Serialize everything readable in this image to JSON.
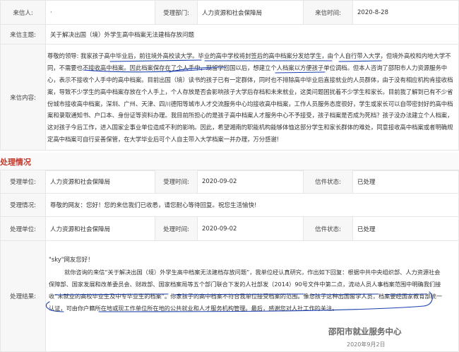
{
  "letter": {
    "row1": {
      "sender_label": "来信人:",
      "sender_value": "·",
      "dept_label": "受理部门:",
      "dept_value": "人力资源和社会保障局",
      "time_label": "来信时间:",
      "time_value": "2020-8-28"
    },
    "subject_label": "来信主题:",
    "subject_value": "关于解决出国（境）外学生高中档案无法建档存放问题",
    "content_label": "来信内容:",
    "content_value": "尊敬的领导: 我家孩子高中毕业后，前往境外高校读大学。毕业的高中学校将封签后的高中档案分发给学生，由个人自行带入大学，但境外高校和内地大学不同，不需要也不接收高中档案。因此档案保存在了个人手中，现留学回国以后，想建立个人档案以方便孩子单位调档。但本人咨询了邵阳市人力资源服务中心，表示不接收个人手中的高中档案。目前出国（境）读书的孩子已有一定群体，同时也不排除高中毕业后直接就业的人员群体，由于没有相应机构肯接收档案，导致不少学生的高中档案存放在个人手上，个人存放是否会影响孩子大学后存档和未来就业，这类问题困扰着不少学生和家长。目前我了解到已有不少省份城市接收高中档案，深圳、广州、天津、四川德阳等城市人才交流服务中心均接收高中档案，工作人员服务态度很好，学生或家长可以自带密封好的高中档案和录取通知书、户口本、身份证等资料办理。我目前所担心的是孩子高中档案人才服务中心不予接受，孩子档案是否成为死档？孩子没办法建立个人档案，这对孩子今后工作，进入国家企事业单位造成不利的影响。因此，希望湘南的职能机构能够体恤这部分学生和家长群体的难处，同意接收高中档案或者明确规定高中档案可自行妥善保管，在大学毕业后可个人自主带入大学档案一并办理，万分感谢!"
  },
  "section_title": "处理情况",
  "process": {
    "accept": {
      "unit_label": "受理单位:",
      "unit_value": "人力资源和社会保障局",
      "time_label": "受理时间:",
      "time_value": "2020-09-02",
      "status_label": "信件状态:",
      "status_value": "已处理"
    },
    "accept_status_label": "受理情况:",
    "accept_status_value": "尊敬的网友：您好！您的来信我们已收悉，请您耐心等待回复。祝您生活愉快!",
    "handle": {
      "unit_label": "处理单位:",
      "unit_value": "人力资源和社会保障局",
      "time_label": "处理时间:",
      "time_value": "2020-09-02",
      "status_label": "信件状态:",
      "status_value": "已处理"
    },
    "result_label": "处理结果:",
    "result_greeting": "\"sky\"网友您好！",
    "result_body": "就你咨询的来信“关于解决出国（境）外学生高中档案无法建档存放问题”，我单位经认真研究，作出如下回复：根据中共中央组织部、人力资源社会保障部、国家发展和改革委员会、财政部、国家档案局等五个部门联合下发的人社部发（2014）90号文件中第二点，流动人员人事档案范围中明确我们接收“未就业的高校毕业生及中专毕业生的档案”。你家孩子的高中档案不符合我单位接受档案的范围。像您孩子这种出国留学人员，档案要经国家教育部统一认证，可由你户籍所在地或现工作单位所在地的公共就业和人才服务机构管理。最后，感谢您对人社工作的关注。",
    "result_org": "邵阳市就业服务中心",
    "result_date": "2020年9月2日"
  }
}
